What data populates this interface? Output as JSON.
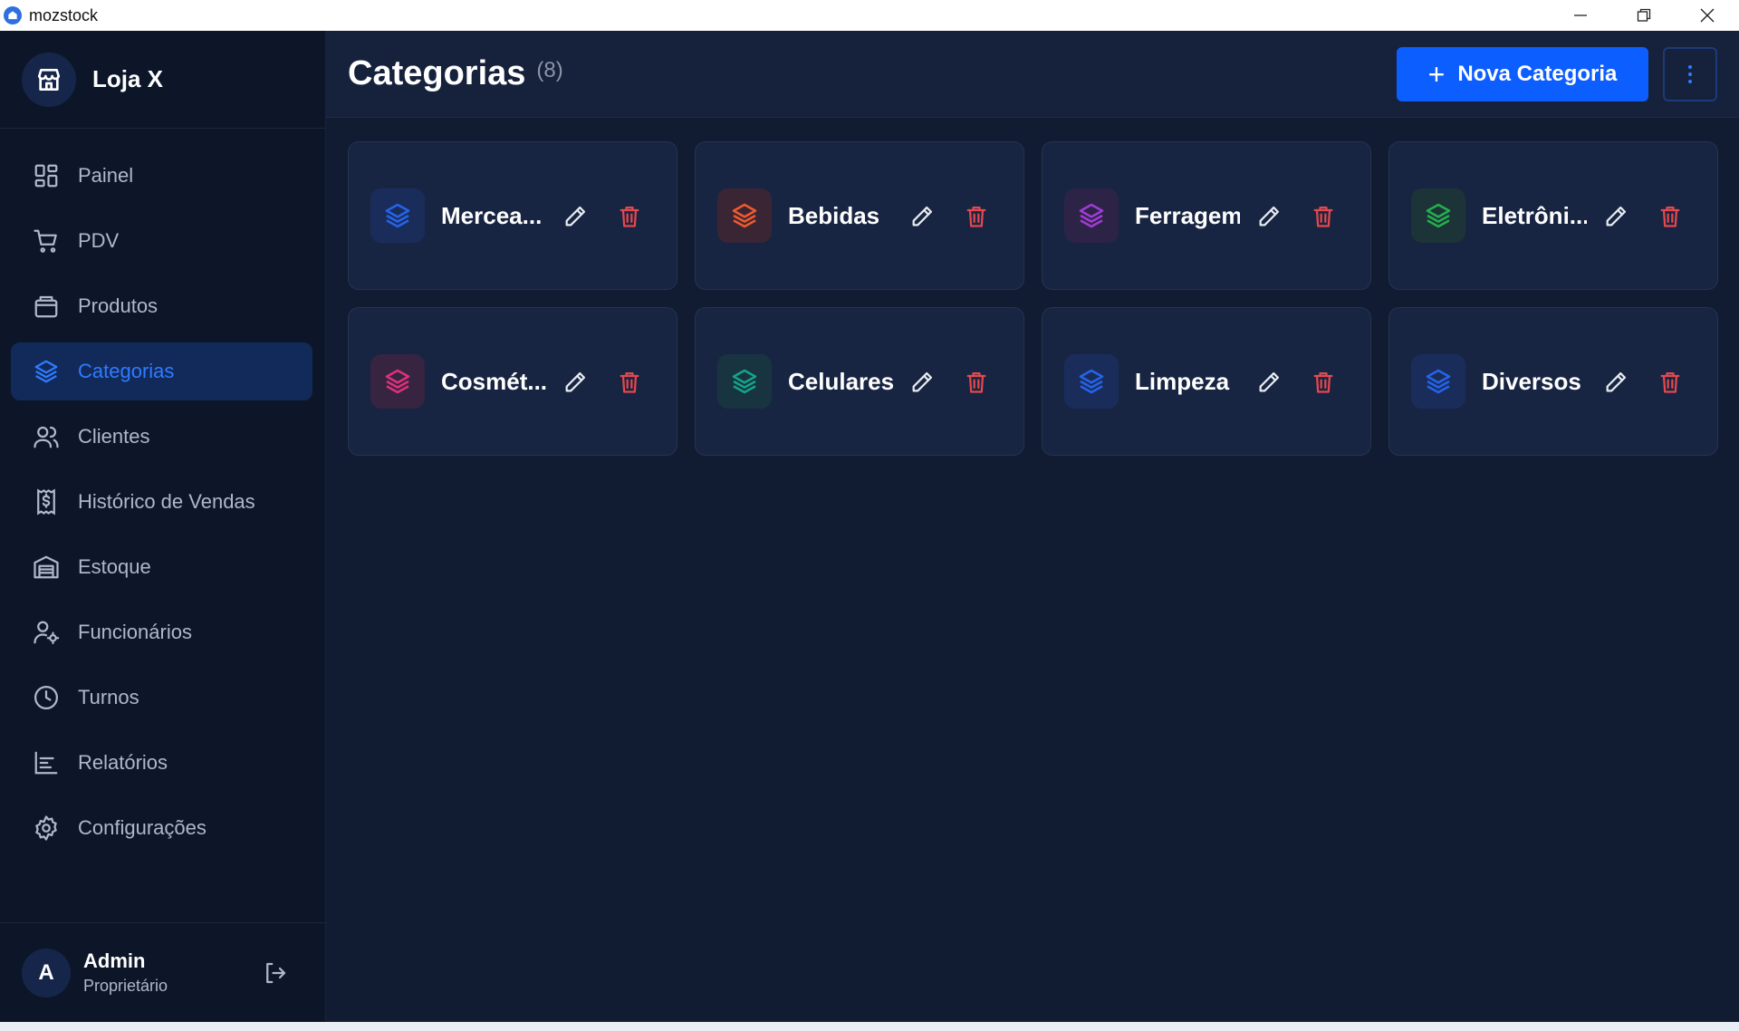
{
  "window": {
    "title": "mozstock",
    "icons": [
      "app-logo-icon",
      "minimize-icon",
      "restore-icon",
      "close-icon"
    ]
  },
  "sidebar": {
    "brand_name": "Loja X",
    "brand_icon": "store-icon",
    "items": [
      {
        "label": "Painel",
        "icon": "dashboard-icon"
      },
      {
        "label": "PDV",
        "icon": "cart-icon"
      },
      {
        "label": "Produtos",
        "icon": "package-icon"
      },
      {
        "label": "Categorias",
        "icon": "layers-icon",
        "active": true
      },
      {
        "label": "Clientes",
        "icon": "users-icon"
      },
      {
        "label": "Histórico de Vendas",
        "icon": "receipt-icon"
      },
      {
        "label": "Estoque",
        "icon": "warehouse-icon"
      },
      {
        "label": "Funcionários",
        "icon": "user-cog-icon"
      },
      {
        "label": "Turnos",
        "icon": "clock-icon"
      },
      {
        "label": "Relatórios",
        "icon": "chart-icon"
      },
      {
        "label": "Configurações",
        "icon": "gear-icon"
      }
    ],
    "user": {
      "initial": "A",
      "name": "Admin",
      "role": "Proprietário",
      "logout_icon": "logout-icon"
    }
  },
  "header": {
    "title": "Categorias",
    "count": "(8)",
    "new_button_label": "Nova Categoria",
    "more_icon": "more-vertical-icon"
  },
  "categories": [
    {
      "name": "Mercea...",
      "color": "#2563eb",
      "bg": "#1a2d5a"
    },
    {
      "name": "Bebidas",
      "color": "#f05a2b",
      "bg": "#3a2535"
    },
    {
      "name": "Ferragem",
      "color": "#a13bd6",
      "bg": "#2c2346"
    },
    {
      "name": "Eletrôni...",
      "color": "#22b04b",
      "bg": "#1c3338"
    },
    {
      "name": "Cosmét...",
      "color": "#e0307a",
      "bg": "#362440"
    },
    {
      "name": "Celulares",
      "color": "#14a38c",
      "bg": "#173440"
    },
    {
      "name": "Limpeza",
      "color": "#2563eb",
      "bg": "#1a2d5a"
    },
    {
      "name": "Diversos",
      "color": "#2563eb",
      "bg": "#1a2d5a"
    }
  ],
  "colors": {
    "accent": "#0d5eff",
    "danger": "#e5484d",
    "sidebar_bg": "#0c1628",
    "main_bg": "#111c33"
  }
}
